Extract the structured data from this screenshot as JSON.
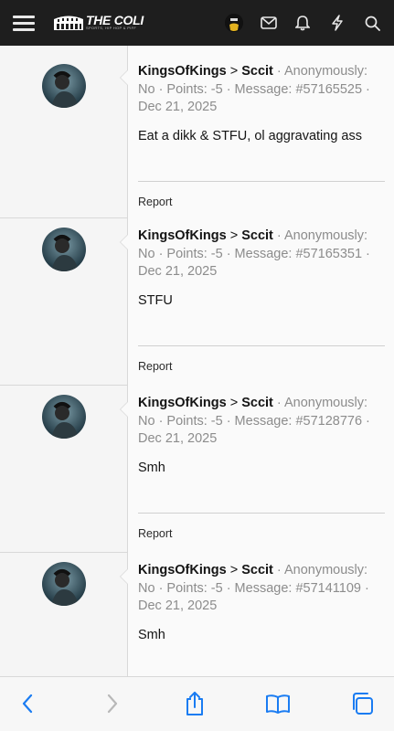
{
  "header": {
    "logo_text": "THE COLI",
    "logo_sub": "SPORTS, HIP HOP & PIFF",
    "icons": [
      "menu-icon",
      "mail-icon",
      "bell-icon",
      "bolt-icon",
      "search-icon"
    ]
  },
  "posts": [
    {
      "user": "KingsOfKings",
      "gt": ">",
      "target": "Sccit",
      "rest": " · Anonymously: No · Points: -5 · Message: #57165525 · Dec 21, 2025",
      "sep1": " ",
      "body": "Eat a dikk & STFU, ol aggravating ass",
      "report": "Report"
    },
    {
      "user": "KingsOfKings",
      "gt": ">",
      "target": "Sccit",
      "rest": " · Anonymously: No · Points: -5 · Message: #57165351 · Dec 21, 2025",
      "sep1": " ",
      "body": "STFU",
      "report": "Report"
    },
    {
      "user": "KingsOfKings",
      "gt": ">",
      "target": "Sccit",
      "rest": " · Anonymously: No · Points: -5 · Message: #57128776 · Dec 21, 2025",
      "sep1": " ",
      "body": "Smh",
      "report": "Report"
    },
    {
      "user": "KingsOfKings",
      "gt": ">",
      "target": "Sccit",
      "rest": " · Anonymously: No · Points: -5 · Message: #57141109 · Dec 21, 2025",
      "sep1": " ",
      "body": "Smh",
      "report": ""
    }
  ],
  "toolbar": {
    "icons": [
      "back-icon",
      "forward-icon",
      "share-icon",
      "bookmarks-icon",
      "tabs-icon"
    ]
  },
  "colors": {
    "accent": "#1a7cf2",
    "header_bg": "#1e1e1e"
  }
}
